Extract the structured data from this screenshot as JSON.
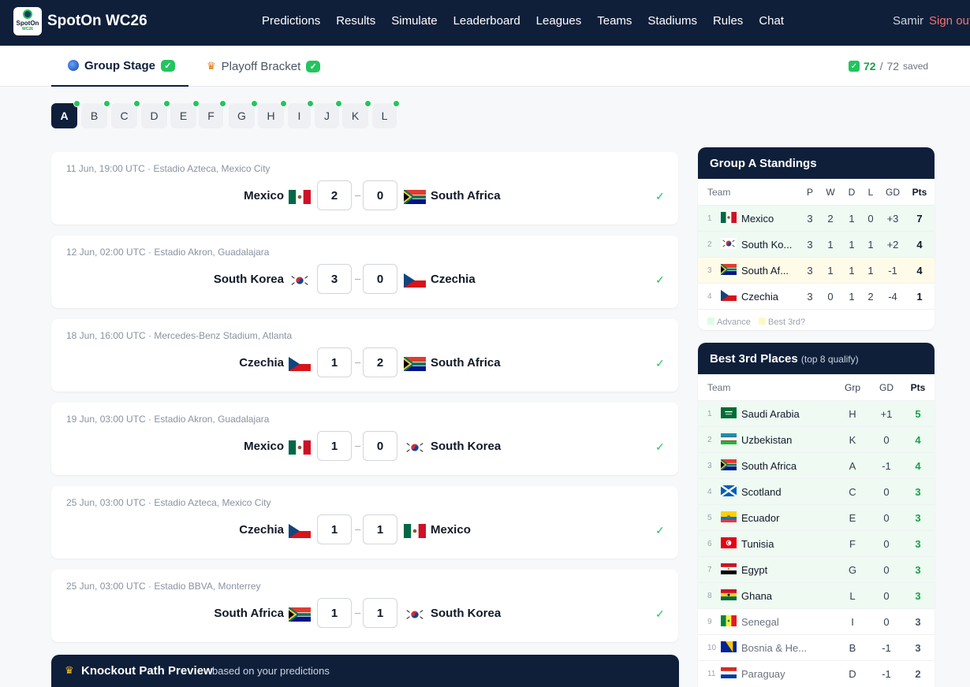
{
  "nav": {
    "brand": "SpotOn WC26",
    "logo_text": "SpotOn",
    "logo_sub": "WC26",
    "links": [
      "Predictions",
      "Results",
      "Simulate",
      "Leaderboard",
      "Leagues",
      "Teams",
      "Stadiums",
      "Rules",
      "Chat"
    ],
    "user": "Samir",
    "signout": "Sign out"
  },
  "tabs": [
    {
      "label": "Group Stage",
      "icon": "globe-icon"
    },
    {
      "label": "Playoff Bracket",
      "icon": "trophy-icon"
    }
  ],
  "saved": {
    "count": "72",
    "sep": "/",
    "total": "72",
    "label": "saved"
  },
  "groups": [
    "A",
    "B",
    "C",
    "D",
    "E",
    "F",
    "G",
    "H",
    "I",
    "J",
    "K",
    "L"
  ],
  "matches": [
    {
      "meta": "11 Jun, 19:00 UTC · Estadio Azteca, Mexico City",
      "home": "Mexico",
      "home_score": "2",
      "away_score": "0",
      "away": "South Africa",
      "hf": "mex",
      "af": "rsa"
    },
    {
      "meta": "12 Jun, 02:00 UTC · Estadio Akron, Guadalajara",
      "home": "South Korea",
      "home_score": "3",
      "away_score": "0",
      "away": "Czechia",
      "hf": "kor",
      "af": "cze"
    },
    {
      "meta": "18 Jun, 16:00 UTC · Mercedes-Benz Stadium, Atlanta",
      "home": "Czechia",
      "home_score": "1",
      "away_score": "2",
      "away": "South Africa",
      "hf": "cze",
      "af": "rsa"
    },
    {
      "meta": "19 Jun, 03:00 UTC · Estadio Akron, Guadalajara",
      "home": "Mexico",
      "home_score": "1",
      "away_score": "0",
      "away": "South Korea",
      "hf": "mex",
      "af": "kor"
    },
    {
      "meta": "25 Jun, 03:00 UTC · Estadio Azteca, Mexico City",
      "home": "Czechia",
      "home_score": "1",
      "away_score": "1",
      "away": "Mexico",
      "hf": "cze",
      "af": "mex"
    },
    {
      "meta": "25 Jun, 03:00 UTC · Estadio BBVA, Monterrey",
      "home": "South Africa",
      "home_score": "1",
      "away_score": "1",
      "away": "South Korea",
      "hf": "rsa",
      "af": "kor"
    }
  ],
  "match_check": "✓",
  "knockout": {
    "title": "Knockout Path Preview",
    "subtitle": "based on your predictions"
  },
  "standings": {
    "title": "Group A Standings",
    "headers": {
      "team": "Team",
      "p": "P",
      "w": "W",
      "d": "D",
      "l": "L",
      "gd": "GD",
      "pts": "Pts"
    },
    "rows": [
      {
        "pos": "1",
        "name": "Mexico",
        "flag": "mex",
        "p": "3",
        "w": "2",
        "d": "1",
        "l": "0",
        "gd": "+3",
        "pts": "7",
        "status": "adv"
      },
      {
        "pos": "2",
        "name": "South Ko...",
        "flag": "kor",
        "p": "3",
        "w": "1",
        "d": "1",
        "l": "1",
        "gd": "+2",
        "pts": "4",
        "status": "adv"
      },
      {
        "pos": "3",
        "name": "South Af...",
        "flag": "rsa",
        "p": "3",
        "w": "1",
        "d": "1",
        "l": "1",
        "gd": "-1",
        "pts": "4",
        "status": "b3"
      },
      {
        "pos": "4",
        "name": "Czechia",
        "flag": "cze",
        "p": "3",
        "w": "0",
        "d": "1",
        "l": "2",
        "gd": "-4",
        "pts": "1",
        "status": ""
      }
    ],
    "legend_advance": "Advance",
    "legend_best3": "Best 3rd?",
    "colors": {
      "advance": "#dcfce7",
      "best3": "#fef9c3"
    }
  },
  "best3": {
    "title": "Best 3rd Places",
    "subtitle": "(top 8 qualify)",
    "headers": {
      "team": "Team",
      "grp": "Grp",
      "gd": "GD",
      "pts": "Pts"
    },
    "rows": [
      {
        "pos": "1",
        "name": "Saudi Arabia",
        "flag": "ksa",
        "grp": "H",
        "gd": "+1",
        "pts": "5",
        "q": true
      },
      {
        "pos": "2",
        "name": "Uzbekistan",
        "flag": "uzb",
        "grp": "K",
        "gd": "0",
        "pts": "4",
        "q": true
      },
      {
        "pos": "3",
        "name": "South Africa",
        "flag": "rsa",
        "grp": "A",
        "gd": "-1",
        "pts": "4",
        "q": true
      },
      {
        "pos": "4",
        "name": "Scotland",
        "flag": "sco",
        "grp": "C",
        "gd": "0",
        "pts": "3",
        "q": true
      },
      {
        "pos": "5",
        "name": "Ecuador",
        "flag": "ecu",
        "grp": "E",
        "gd": "0",
        "pts": "3",
        "q": true
      },
      {
        "pos": "6",
        "name": "Tunisia",
        "flag": "tun",
        "grp": "F",
        "gd": "0",
        "pts": "3",
        "q": true
      },
      {
        "pos": "7",
        "name": "Egypt",
        "flag": "egy",
        "grp": "G",
        "gd": "0",
        "pts": "3",
        "q": true
      },
      {
        "pos": "8",
        "name": "Ghana",
        "flag": "gha",
        "grp": "L",
        "gd": "0",
        "pts": "3",
        "q": true
      },
      {
        "pos": "9",
        "name": "Senegal",
        "flag": "sen",
        "grp": "I",
        "gd": "0",
        "pts": "3",
        "q": false
      },
      {
        "pos": "10",
        "name": "Bosnia & He...",
        "flag": "bih",
        "grp": "B",
        "gd": "-1",
        "pts": "3",
        "q": false
      },
      {
        "pos": "11",
        "name": "Paraguay",
        "flag": "par",
        "grp": "D",
        "gd": "-1",
        "pts": "2",
        "q": false
      }
    ]
  },
  "colors": {
    "navy": "#0f1f3a",
    "green": "#22c55e",
    "red": "#f87171"
  }
}
